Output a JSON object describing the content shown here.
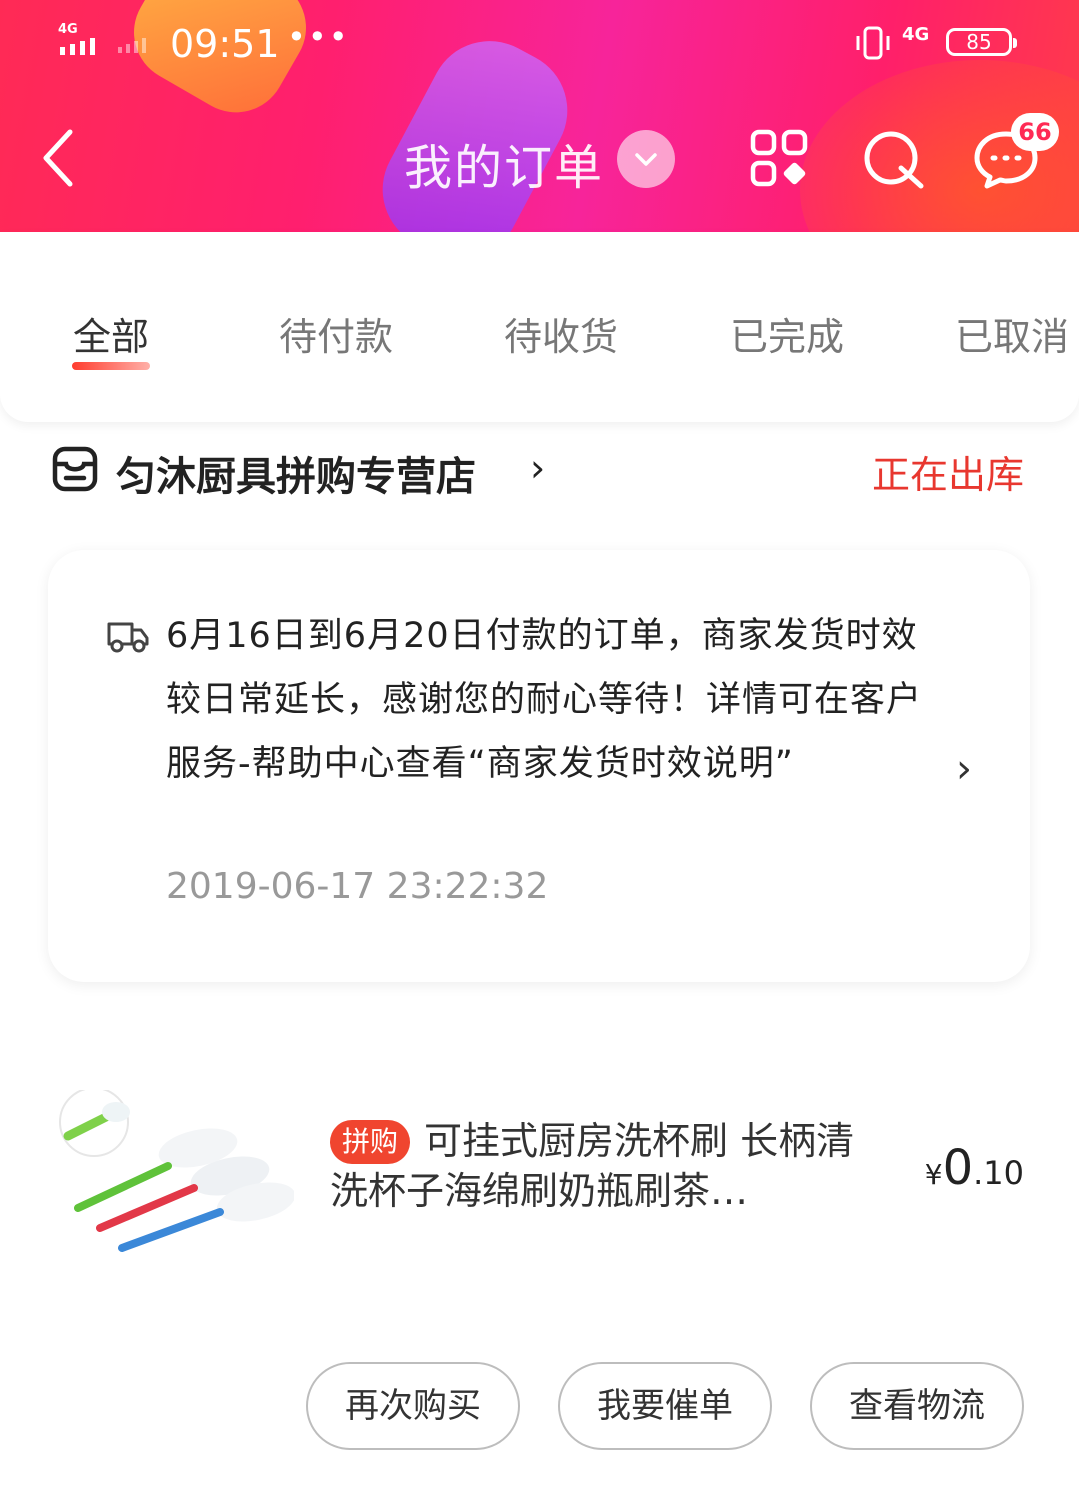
{
  "status_bar": {
    "network": "4G",
    "time": "09:51",
    "more": "•••",
    "network2": "4G",
    "battery": "85"
  },
  "nav": {
    "title": "我的订单",
    "message_badge": "66",
    "icons": [
      "back-icon",
      "dropdown-icon",
      "grid-icon",
      "search-icon",
      "message-icon"
    ]
  },
  "tabs": [
    {
      "label": "全部",
      "active": true
    },
    {
      "label": "待付款",
      "active": false
    },
    {
      "label": "待收货",
      "active": false
    },
    {
      "label": "已完成",
      "active": false
    },
    {
      "label": "已取消",
      "active": false
    }
  ],
  "order": {
    "store_name": "匀沐厨具拼购专营店",
    "store_chevron": "›",
    "status": "正在出库",
    "notice": {
      "text": "6月16日到6月20日付款的订单，商家发货时效较日常延长，感谢您的耐心等待！详情可在客户服务-帮助中心查看“商家发货时效说明”",
      "time": "2019-06-17 23:22:32",
      "chevron": "›"
    },
    "product": {
      "tag": "拼购",
      "title": "可挂式厨房洗杯刷 长柄清洗杯子海绵刷奶瓶刷茶…",
      "price_symbol": "¥",
      "price_int": "0",
      "price_dec": ".10"
    },
    "actions": {
      "rebuy": "再次购买",
      "urge": "我要催单",
      "logistics": "查看物流"
    }
  },
  "colors": {
    "accent": "#e8372f",
    "header_start": "#ff2a55",
    "header_mid": "#f7249a"
  }
}
